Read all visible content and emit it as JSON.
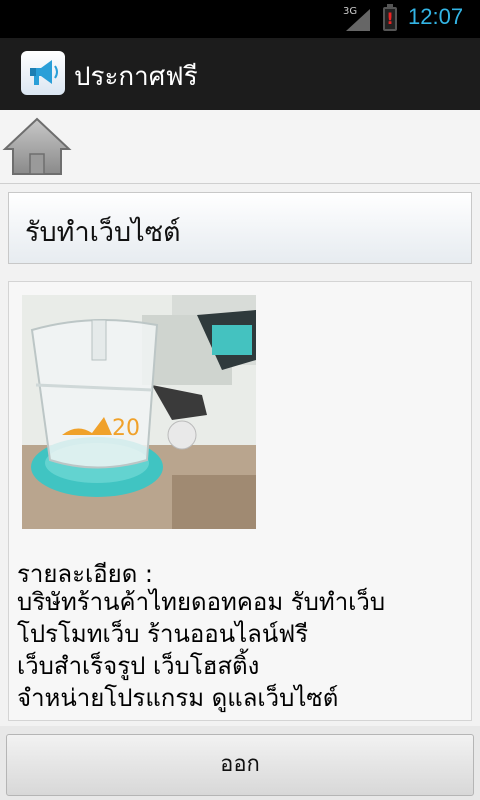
{
  "status_bar": {
    "network": "3G",
    "time": "12:07",
    "icons": [
      "signal-icon",
      "battery-warning-icon"
    ],
    "time_color": "#33b5e5"
  },
  "action_bar": {
    "app_icon": "megaphone-icon",
    "title": "ประกาศฟรี"
  },
  "nav": {
    "home_icon": "home-icon"
  },
  "listing": {
    "title": "รับทำเว็บไซต์",
    "image": "glass-mug-photo",
    "detail_label": "รายละเอียด :",
    "detail_text": "บริษัทร้านค้าไทยดอทคอม รับทำเว็บ\nโปรโมทเว็บ ร้านออนไลน์ฟรี\nเว็บสำเร็จรูป เว็บโฮสติ้ง\nจำหน่ายโปรแกรม ดูแลเว็บไซต์"
  },
  "footer": {
    "exit_label": "ออก"
  }
}
